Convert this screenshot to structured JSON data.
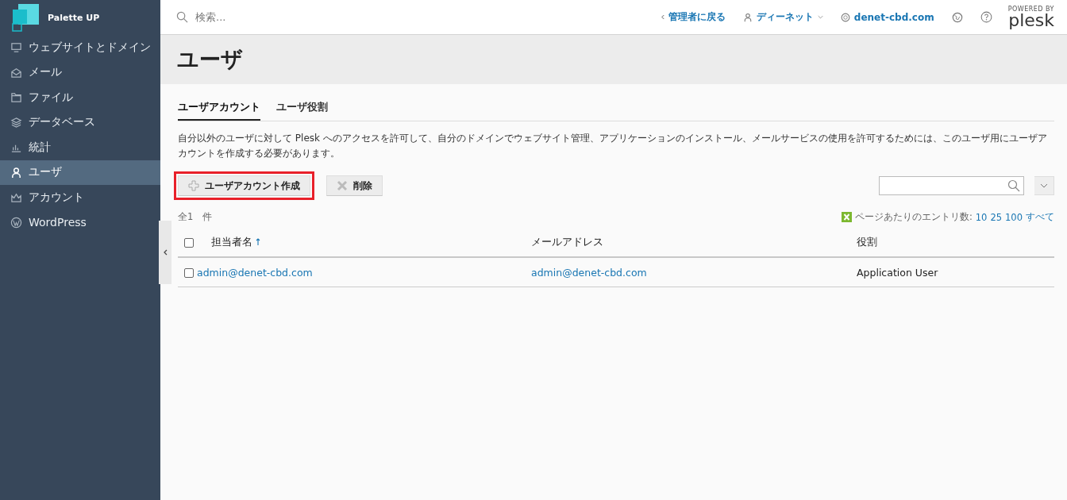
{
  "sidebar": {
    "brand": "Palette UP",
    "items": [
      {
        "label": "ウェブサイトとドメイン",
        "selected": false
      },
      {
        "label": "メール",
        "selected": false
      },
      {
        "label": "ファイル",
        "selected": false
      },
      {
        "label": "データベース",
        "selected": false
      },
      {
        "label": "統計",
        "selected": false
      },
      {
        "label": "ユーザ",
        "selected": true
      },
      {
        "label": "アカウント",
        "selected": false
      },
      {
        "label": "WordPress",
        "selected": false
      }
    ]
  },
  "topbar": {
    "search_placeholder": "検索...",
    "back_link": "管理者に戻る",
    "user": "ディーネット",
    "domain": "denet-cbd.com",
    "powered_by": "POWERED BY",
    "logo": "plesk"
  },
  "page_title": "ユーザ",
  "tabs": [
    {
      "label": "ユーザアカウント",
      "selected": true
    },
    {
      "label": "ユーザ役割",
      "selected": false
    }
  ],
  "description": "自分以外のユーザに対して Plesk へのアクセスを許可して、自分のドメインでウェブサイト管理、アプリケーションのインストール、メールサービスの使用を許可するためには、このユーザ用にユーザアカウントを作成する必要があります。",
  "toolbar": [
    {
      "label": "ユーザアカウント作成",
      "kind": "add",
      "highlighted": true
    },
    {
      "label": "削除",
      "kind": "delete",
      "highlighted": false
    }
  ],
  "total": "全1　件",
  "per_page": {
    "label": "ページあたりのエントリ数:",
    "options": [
      "10",
      "25",
      "100",
      "すべて"
    ]
  },
  "table": {
    "all_selected": false,
    "columns": [
      {
        "label": "担当者名",
        "sorted": true
      },
      {
        "label": "メールアドレス",
        "sorted": false
      },
      {
        "label": "役割",
        "sorted": false
      }
    ],
    "rows": [
      {
        "checked": false,
        "cells": [
          "admin@denet-cbd.com",
          "admin@denet-cbd.com",
          "Application User"
        ]
      }
    ]
  }
}
